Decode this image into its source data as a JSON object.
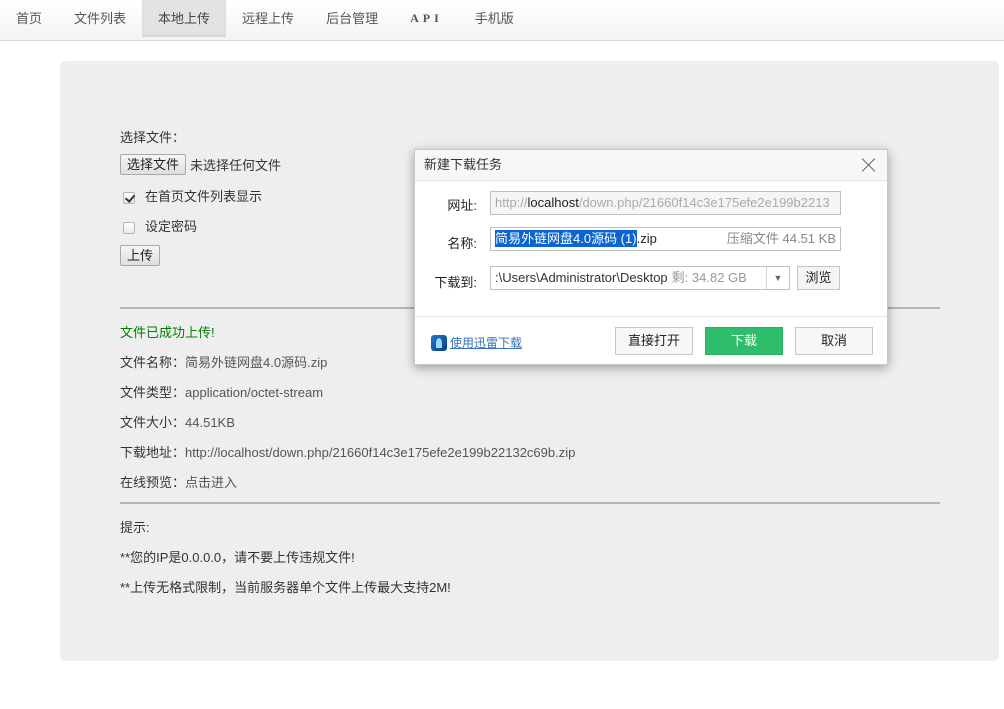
{
  "nav": {
    "items": [
      {
        "label": "首页",
        "active": false
      },
      {
        "label": "文件列表",
        "active": false
      },
      {
        "label": "本地上传",
        "active": true
      },
      {
        "label": "远程上传",
        "active": false
      },
      {
        "label": "后台管理",
        "active": false
      },
      {
        "label": "API",
        "active": false
      },
      {
        "label": "手机版",
        "active": false
      }
    ]
  },
  "upload_form": {
    "choose_file_label": "选择文件：",
    "choose_file_button": "选择文件",
    "no_file_text": "未选择任何文件",
    "show_on_home_label": "在首页文件列表显示",
    "show_on_home_checked": true,
    "set_password_label": "设定密码",
    "set_password_checked": false,
    "upload_button": "上传"
  },
  "result": {
    "success_message": "文件已成功上传!",
    "file_name_label": "文件名称：",
    "file_name": "简易外链网盘4.0源码.zip",
    "file_type_label": "文件类型：",
    "file_type": "application/octet-stream",
    "file_size_label": "文件大小：",
    "file_size": "44.51KB",
    "download_url_label": "下载地址：",
    "download_url": "http://localhost/down.php/21660f14c3e175efe2e199b22132c69b.zip",
    "preview_label": "在线预览：",
    "preview_link": "点击进入"
  },
  "tips": {
    "title": "提示:",
    "lines": [
      "**您的IP是0.0.0.0，请不要上传违规文件!",
      "**上传无格式限制，当前服务器单个文件上传最大支持2M!"
    ]
  },
  "dialog": {
    "title": "新建下载任务",
    "url_label": "网址:",
    "url_prefix": "http://",
    "url_host": "localhost",
    "url_rest": "/down.php/21660f14c3e175efe2e199b2213",
    "name_label": "名称:",
    "name_selected": "简易外链网盘4.0源码 (1)",
    "name_ext": ".zip",
    "name_meta": "压缩文件 44.51 KB",
    "save_to_label": "下载到:",
    "save_path": ":\\Users\\Administrator\\Desktop",
    "free_space": "剩: 34.82 GB",
    "browse_button": "浏览",
    "thunder_link": "使用迅雷下载",
    "open_button": "直接打开",
    "download_button": "下载",
    "cancel_button": "取消"
  }
}
